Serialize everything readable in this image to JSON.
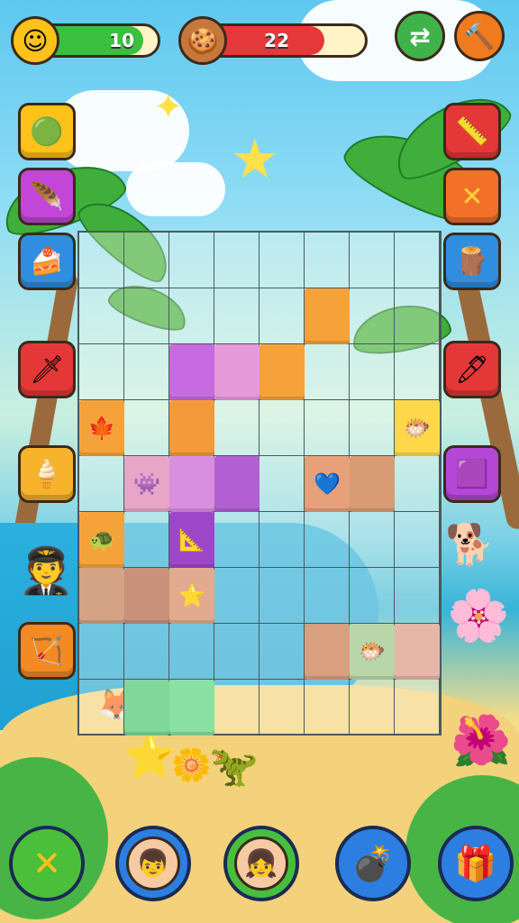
{
  "hud": {
    "energy_value": "10",
    "energy_fill": 0.88,
    "energy_icon": "coin-icon",
    "lives_value": "22",
    "lives_fill": 0.75,
    "lives_icon": "cookie-icon",
    "top_right_buttons": [
      "swap-icon",
      "hammer-icon"
    ]
  },
  "left_tools": [
    "green-orb-icon",
    "purple-feather-icon",
    "layered-cake-icon",
    "sword-icon",
    "popsicle-icon",
    "bow-icon"
  ],
  "right_tools": [
    "ruler-icon",
    "cross-icon",
    "wooden-club-icon",
    "quill-icon",
    "purple-frame-icon"
  ],
  "board": {
    "cols": 8,
    "rows": 9,
    "placed_pieces": [
      {
        "col": 5,
        "row": 1,
        "color": "#f6a23a",
        "icon": ""
      },
      {
        "col": 2,
        "row": 2,
        "color": "#c76be0",
        "icon": ""
      },
      {
        "col": 3,
        "row": 2,
        "color": "#e79ad9",
        "icon": ""
      },
      {
        "col": 4,
        "row": 2,
        "color": "#f6a23a",
        "icon": ""
      },
      {
        "col": 0,
        "row": 3,
        "color": "#f6a23a",
        "icon": "🍁"
      },
      {
        "col": 2,
        "row": 3,
        "color": "#f39a3a",
        "icon": ""
      },
      {
        "col": 7,
        "row": 3,
        "color": "#ffd84a",
        "icon": "🐡"
      },
      {
        "col": 1,
        "row": 4,
        "color": "#e7a6c8",
        "icon": "👾"
      },
      {
        "col": 2,
        "row": 4,
        "color": "#d98fe0",
        "icon": ""
      },
      {
        "col": 3,
        "row": 4,
        "color": "#b25fd2",
        "icon": ""
      },
      {
        "col": 5,
        "row": 4,
        "color": "#e6a07a",
        "icon": "💙"
      },
      {
        "col": 6,
        "row": 4,
        "color": "#d99b74",
        "icon": ""
      },
      {
        "col": 0,
        "row": 5,
        "color": "#f6a23a",
        "icon": "🐢"
      },
      {
        "col": 2,
        "row": 5,
        "color": "#9d47c8",
        "icon": "📐"
      },
      {
        "col": 0,
        "row": 6,
        "color": "#d4a284",
        "icon": ""
      },
      {
        "col": 1,
        "row": 6,
        "color": "#c9917a",
        "icon": ""
      },
      {
        "col": 2,
        "row": 6,
        "color": "#e2ab8f",
        "icon": "⭐"
      },
      {
        "col": 5,
        "row": 7,
        "color": "#d9a07f",
        "icon": ""
      },
      {
        "col": 6,
        "row": 7,
        "color": "#b9d6a8",
        "icon": "🐡"
      },
      {
        "col": 7,
        "row": 7,
        "color": "#e6b6a8",
        "icon": ""
      },
      {
        "col": 1,
        "row": 8,
        "color": "#7fd89a",
        "icon": ""
      },
      {
        "col": 2,
        "row": 8,
        "color": "#8be0a3",
        "icon": ""
      }
    ]
  },
  "bottom_bar": [
    "close-icon",
    "boy-avatar-icon",
    "girl-avatar-icon",
    "bomb-icon",
    "treasure-box-icon"
  ]
}
